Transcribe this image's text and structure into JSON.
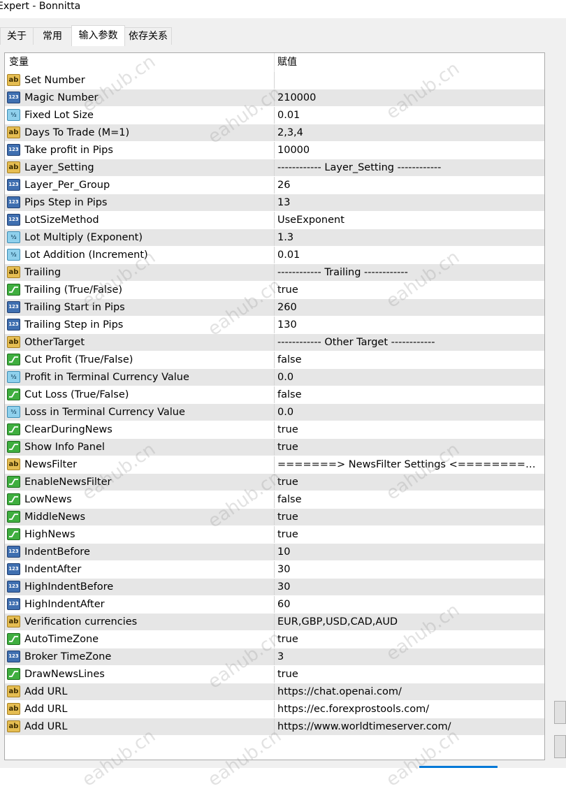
{
  "window": {
    "title": "Expert - Bonnitta"
  },
  "tabs": [
    {
      "label": "关于",
      "active": false
    },
    {
      "label": "常用",
      "active": false
    },
    {
      "label": "输入参数",
      "active": true
    },
    {
      "label": "依存关系",
      "active": false
    }
  ],
  "grid": {
    "columns": {
      "variable": "变量",
      "value": "赋值"
    },
    "rows": [
      {
        "icon": "ab",
        "name": "Set Number",
        "value": ""
      },
      {
        "icon": "123",
        "name": "Magic Number",
        "value": "210000"
      },
      {
        "icon": "frac",
        "name": "Fixed Lot Size",
        "value": "0.01"
      },
      {
        "icon": "ab",
        "name": "Days To Trade (M=1)",
        "value": "2,3,4"
      },
      {
        "icon": "123",
        "name": "Take profit in Pips",
        "value": "10000"
      },
      {
        "icon": "ab",
        "name": "Layer_Setting",
        "value": "------------ Layer_Setting ------------"
      },
      {
        "icon": "123",
        "name": "Layer_Per_Group",
        "value": "26"
      },
      {
        "icon": "123",
        "name": "Pips Step in Pips",
        "value": "13"
      },
      {
        "icon": "123",
        "name": "LotSizeMethod",
        "value": "UseExponent"
      },
      {
        "icon": "frac",
        "name": "Lot Multiply (Exponent)",
        "value": "1.3"
      },
      {
        "icon": "frac",
        "name": "Lot Addition (Increment)",
        "value": "0.01"
      },
      {
        "icon": "ab",
        "name": "Trailing",
        "value": "------------ Trailing ------------"
      },
      {
        "icon": "bool",
        "name": "Trailing (True/False)",
        "value": "true"
      },
      {
        "icon": "123",
        "name": "Trailing Start in Pips",
        "value": "260"
      },
      {
        "icon": "123",
        "name": "Trailing Step in Pips",
        "value": "130"
      },
      {
        "icon": "ab",
        "name": "OtherTarget",
        "value": "------------ Other Target ------------"
      },
      {
        "icon": "bool",
        "name": "Cut Profit (True/False)",
        "value": "false"
      },
      {
        "icon": "frac",
        "name": "Profit in Terminal Currency Value",
        "value": "0.0"
      },
      {
        "icon": "bool",
        "name": "Cut Loss (True/False)",
        "value": "false"
      },
      {
        "icon": "frac",
        "name": "Loss in Terminal Currency Value",
        "value": "0.0"
      },
      {
        "icon": "bool",
        "name": "ClearDuringNews",
        "value": "true"
      },
      {
        "icon": "bool",
        "name": "Show Info Panel",
        "value": "true"
      },
      {
        "icon": "ab",
        "name": "NewsFilter",
        "value": "=======>  NewsFilter Settings <===========..."
      },
      {
        "icon": "bool",
        "name": "EnableNewsFilter",
        "value": "true"
      },
      {
        "icon": "bool",
        "name": "LowNews",
        "value": "false"
      },
      {
        "icon": "bool",
        "name": "MiddleNews",
        "value": "true"
      },
      {
        "icon": "bool",
        "name": "HighNews",
        "value": "true"
      },
      {
        "icon": "123",
        "name": "IndentBefore",
        "value": "10"
      },
      {
        "icon": "123",
        "name": "IndentAfter",
        "value": "30"
      },
      {
        "icon": "123",
        "name": "HighIndentBefore",
        "value": "30"
      },
      {
        "icon": "123",
        "name": "HighIndentAfter",
        "value": "60"
      },
      {
        "icon": "ab",
        "name": "Verification currencies",
        "value": "EUR,GBP,USD,CAD,AUD"
      },
      {
        "icon": "bool",
        "name": "AutoTimeZone",
        "value": "true"
      },
      {
        "icon": "123",
        "name": "Broker TimeZone",
        "value": "3"
      },
      {
        "icon": "bool",
        "name": "DrawNewsLines",
        "value": "true"
      },
      {
        "icon": "ab",
        "name": "Add URL",
        "value": "https://chat.openai.com/"
      },
      {
        "icon": "ab",
        "name": "Add URL",
        "value": "https://ec.forexprostools.com/"
      },
      {
        "icon": "ab",
        "name": "Add URL",
        "value": "https://www.worldtimeserver.com/"
      }
    ]
  },
  "icon_labels": {
    "ab": "ab",
    "123": "123",
    "frac": "½"
  },
  "watermark": {
    "text": "eahub.cn"
  },
  "colors": {
    "alt_row": "#e6e6e6",
    "string_icon": "#e5bd52",
    "int_icon": "#3f6fb0",
    "double_icon": "#8fd0ec",
    "bool_icon": "#3fae3f",
    "accent": "#0078d7"
  }
}
